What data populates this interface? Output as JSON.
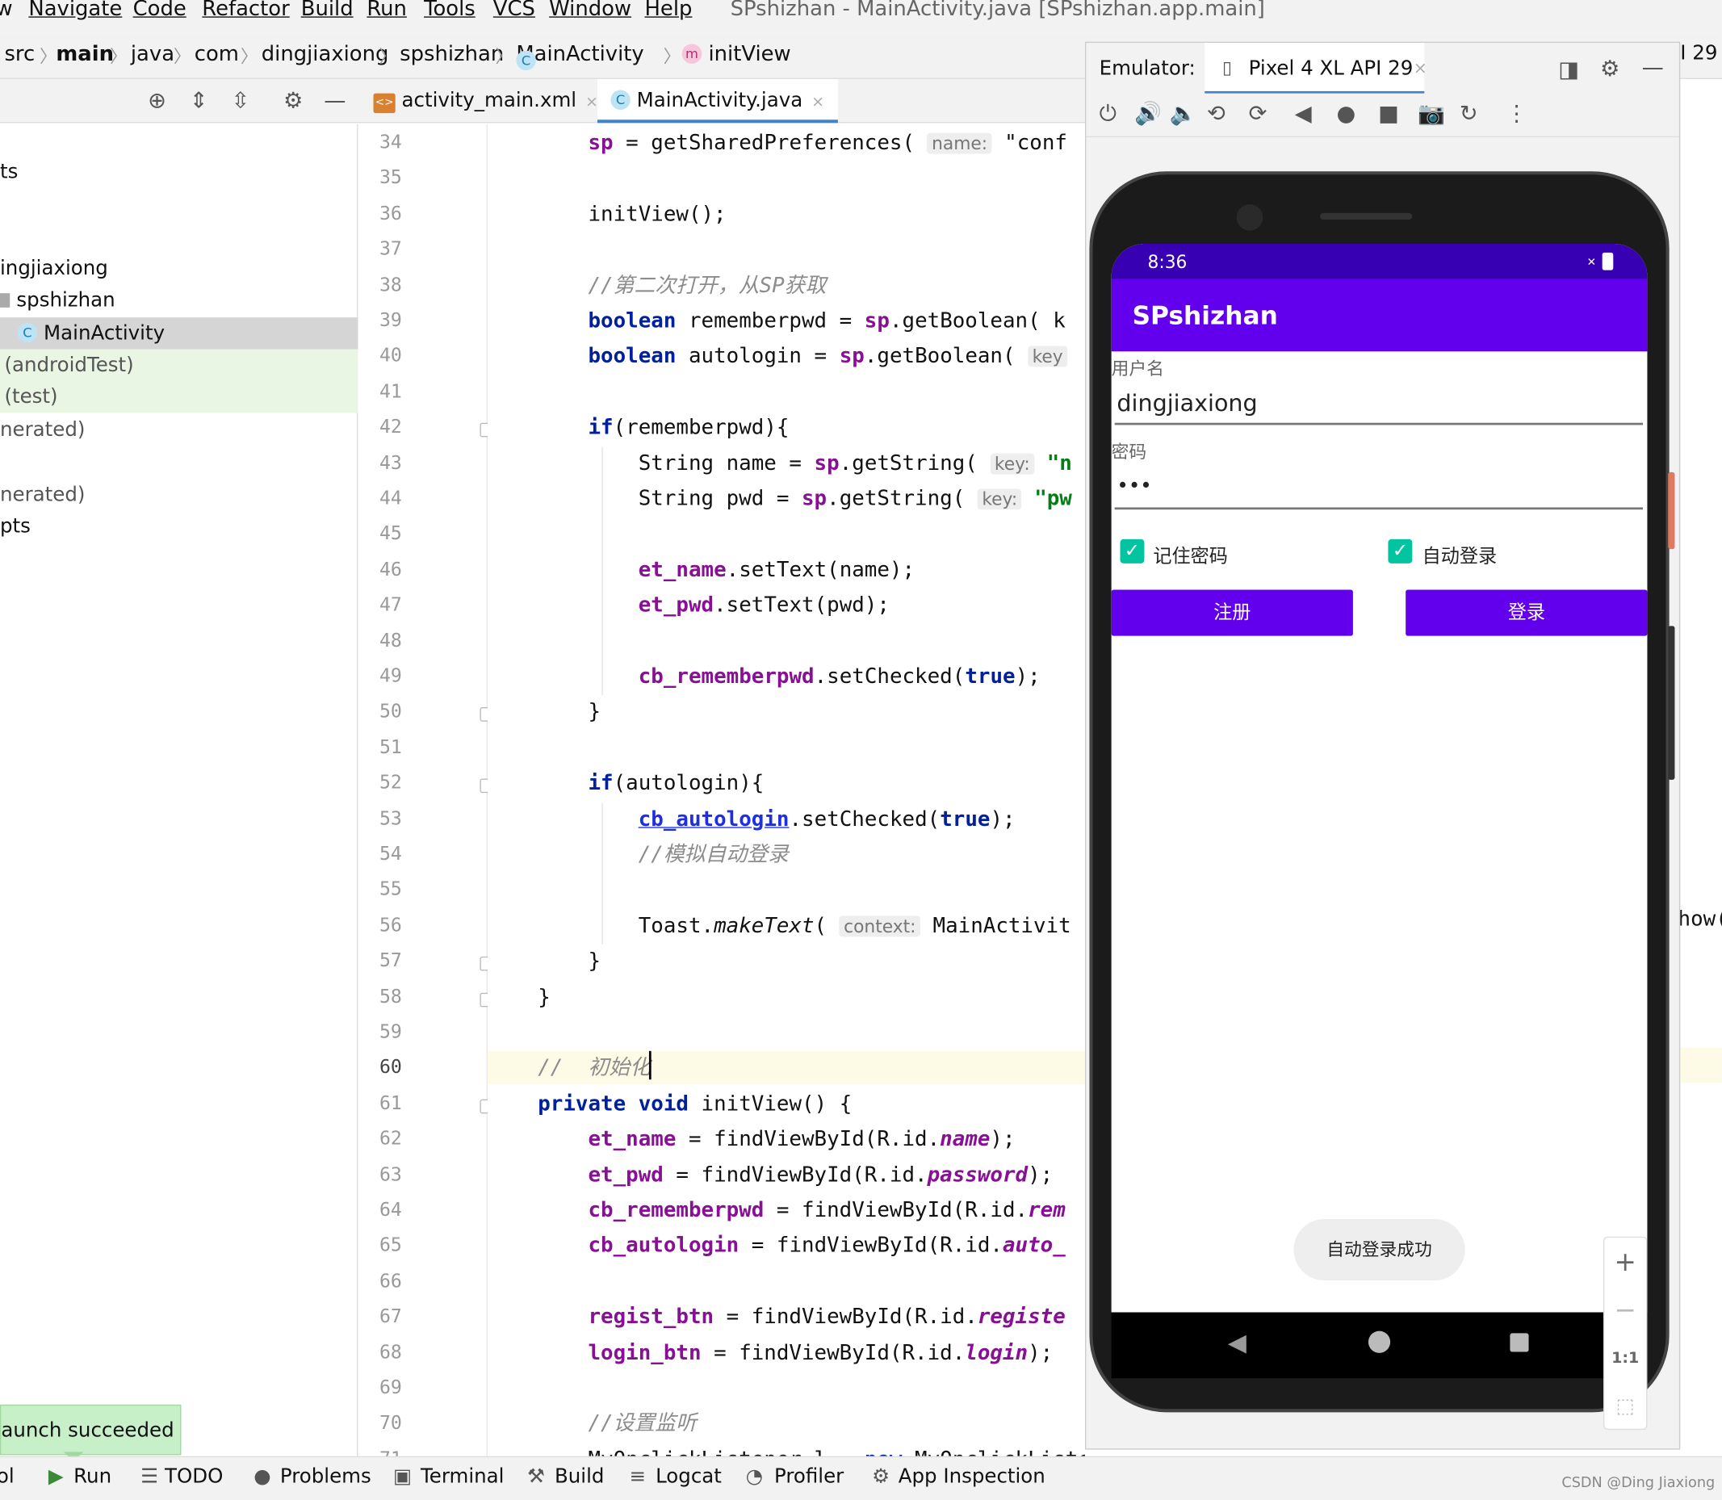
{
  "menu": {
    "items": [
      "w",
      "Navigate",
      "Code",
      "Refactor",
      "Build",
      "Run",
      "Tools",
      "VCS",
      "Window",
      "Help"
    ],
    "window_title": "SPshizhan - MainActivity.java [SPshizhan.app.main]"
  },
  "breadcrumb": {
    "items": [
      "src",
      "main",
      "java",
      "com",
      "dingjiaxiong",
      "spshizhan",
      "MainActivity",
      "initView"
    ],
    "class_badge": "C",
    "method_badge": "m",
    "right_fragment": "I 29"
  },
  "project_tree": {
    "rows": [
      {
        "label": "ts"
      },
      {
        "label": "ingjiaxiong"
      },
      {
        "label": "spshizhan"
      },
      {
        "label": "MainActivity",
        "badge": "C"
      },
      {
        "label": "(androidTest)"
      },
      {
        "label": "(test)"
      },
      {
        "label": "nerated)"
      },
      {
        "label": "nerated)"
      },
      {
        "label": "pts"
      }
    ]
  },
  "editor_tabs": [
    {
      "label": "activity_main.xml",
      "icon": "xml-file-icon",
      "icon_text": "<>",
      "close": "×"
    },
    {
      "label": "MainActivity.java",
      "icon": "java-class-icon",
      "icon_text": "C",
      "close": "×",
      "active": true
    }
  ],
  "editor": {
    "line_numbers": [
      "34",
      "35",
      "36",
      "37",
      "38",
      "39",
      "40",
      "41",
      "42",
      "43",
      "44",
      "45",
      "46",
      "47",
      "48",
      "49",
      "50",
      "51",
      "52",
      "53",
      "54",
      "55",
      "56",
      "57",
      "58",
      "59",
      "60",
      "61",
      "62",
      "63",
      "64",
      "65",
      "66",
      "67",
      "68",
      "69",
      "70",
      "71"
    ],
    "current_line": "60",
    "lines": [
      {
        "segs": [
          [
            "        ",
            ""
          ],
          [
            "sp",
            "fld"
          ],
          [
            " = getSharedPreferences( ",
            ""
          ],
          [
            "name:",
            "hint"
          ],
          [
            " ",
            ""
          ],
          [
            "\"conf",
            ""
          ]
        ]
      },
      {
        "segs": []
      },
      {
        "segs": [
          [
            "        initView();",
            ""
          ]
        ]
      },
      {
        "segs": []
      },
      {
        "segs": [
          [
            "        ",
            ""
          ],
          [
            "//第二次打开，从SP获取",
            "cm"
          ]
        ]
      },
      {
        "segs": [
          [
            "        ",
            ""
          ],
          [
            "boolean",
            "kw"
          ],
          [
            " rememberpwd = ",
            ""
          ],
          [
            "sp",
            "fld"
          ],
          [
            ".getBoolean( k",
            ""
          ]
        ]
      },
      {
        "segs": [
          [
            "        ",
            ""
          ],
          [
            "boolean",
            "kw"
          ],
          [
            " autologin = ",
            ""
          ],
          [
            "sp",
            "fld"
          ],
          [
            ".getBoolean( ",
            ""
          ],
          [
            "key",
            "hint"
          ]
        ]
      },
      {
        "segs": []
      },
      {
        "segs": [
          [
            "        ",
            ""
          ],
          [
            "if",
            "kw"
          ],
          [
            "(rememberpwd){",
            ""
          ]
        ]
      },
      {
        "segs": [
          [
            "            String name = ",
            ""
          ],
          [
            "sp",
            "fld"
          ],
          [
            ".getString( ",
            ""
          ],
          [
            "key:",
            "hint"
          ],
          [
            " ",
            ""
          ],
          [
            "\"n",
            "str"
          ]
        ]
      },
      {
        "segs": [
          [
            "            String pwd = ",
            ""
          ],
          [
            "sp",
            "fld"
          ],
          [
            ".getString( ",
            ""
          ],
          [
            "key:",
            "hint"
          ],
          [
            " ",
            ""
          ],
          [
            "\"pw",
            "str"
          ]
        ]
      },
      {
        "segs": []
      },
      {
        "segs": [
          [
            "            ",
            ""
          ],
          [
            "et_name",
            "fld"
          ],
          [
            ".setText(name);",
            ""
          ]
        ]
      },
      {
        "segs": [
          [
            "            ",
            ""
          ],
          [
            "et_pwd",
            "fld"
          ],
          [
            ".setText(pwd);",
            ""
          ]
        ]
      },
      {
        "segs": []
      },
      {
        "segs": [
          [
            "            ",
            ""
          ],
          [
            "cb_rememberpwd",
            "fld"
          ],
          [
            ".setChecked(",
            ""
          ],
          [
            "true",
            "kw"
          ],
          [
            ");",
            ""
          ]
        ]
      },
      {
        "segs": [
          [
            "        }",
            ""
          ]
        ]
      },
      {
        "segs": []
      },
      {
        "segs": [
          [
            "        ",
            ""
          ],
          [
            "if",
            "kw"
          ],
          [
            "(autologin){",
            ""
          ]
        ]
      },
      {
        "segs": [
          [
            "            ",
            ""
          ],
          [
            "cb_autologin",
            "fldu"
          ],
          [
            ".setChecked(",
            ""
          ],
          [
            "true",
            "kw"
          ],
          [
            ");",
            ""
          ]
        ]
      },
      {
        "segs": [
          [
            "            ",
            ""
          ],
          [
            "//模拟自动登录",
            "cm"
          ]
        ]
      },
      {
        "segs": []
      },
      {
        "segs": [
          [
            "            Toast.",
            ""
          ],
          [
            "makeText",
            "it"
          ],
          [
            "( ",
            ""
          ],
          [
            "context:",
            "hint"
          ],
          [
            " MainActivit",
            ""
          ]
        ]
      },
      {
        "segs": [
          [
            "        }",
            ""
          ]
        ]
      },
      {
        "segs": [
          [
            "    }",
            ""
          ]
        ]
      },
      {
        "segs": []
      },
      {
        "segs": [
          [
            "    ",
            ""
          ],
          [
            "//  初始化",
            "cm"
          ]
        ]
      },
      {
        "segs": [
          [
            "    ",
            ""
          ],
          [
            "private void",
            "kw"
          ],
          [
            " initView() {",
            ""
          ]
        ]
      },
      {
        "segs": [
          [
            "        ",
            ""
          ],
          [
            "et_name",
            "fld"
          ],
          [
            " = findViewById(R.id.",
            ""
          ],
          [
            "name",
            "itf"
          ],
          [
            ");",
            ""
          ]
        ]
      },
      {
        "segs": [
          [
            "        ",
            ""
          ],
          [
            "et_pwd",
            "fld"
          ],
          [
            " = findViewById(R.id.",
            ""
          ],
          [
            "password",
            "itf"
          ],
          [
            ");",
            ""
          ]
        ]
      },
      {
        "segs": [
          [
            "        ",
            ""
          ],
          [
            "cb_rememberpwd",
            "fld"
          ],
          [
            " = findViewById(R.id.",
            ""
          ],
          [
            "rem",
            "itf"
          ]
        ]
      },
      {
        "segs": [
          [
            "        ",
            ""
          ],
          [
            "cb_autologin",
            "fld"
          ],
          [
            " = findViewById(R.id.",
            ""
          ],
          [
            "auto_",
            "itf"
          ]
        ]
      },
      {
        "segs": []
      },
      {
        "segs": [
          [
            "        ",
            ""
          ],
          [
            "regist_btn",
            "fld"
          ],
          [
            " = findViewById(R.id.",
            ""
          ],
          [
            "registe",
            "itf"
          ]
        ]
      },
      {
        "segs": [
          [
            "        ",
            ""
          ],
          [
            "login_btn",
            "fld"
          ],
          [
            " = findViewById(R.id.",
            ""
          ],
          [
            "login",
            "itf"
          ],
          [
            ");",
            ""
          ]
        ]
      },
      {
        "segs": []
      },
      {
        "segs": [
          [
            "        ",
            ""
          ],
          [
            "//设置监听",
            "cm"
          ]
        ]
      },
      {
        "segs": [
          [
            "        MyOnclickListener l = ",
            ""
          ],
          [
            "new",
            "kw"
          ],
          [
            " MyOnclickListener();",
            ""
          ]
        ]
      }
    ],
    "overflow_text": "how("
  },
  "emulator": {
    "label": "Emulator:",
    "device": "Pixel 4 XL API 29",
    "close": "×",
    "toolbar_icons": [
      "power-icon",
      "volume-up-icon",
      "volume-down-icon",
      "rotate-left-icon",
      "rotate-right-icon",
      "back-icon",
      "home-icon",
      "overview-icon",
      "screenshot-icon",
      "snapshot-icon",
      "more-icon"
    ],
    "zoom": {
      "plus": "+",
      "minus": "−",
      "one_to_one": "1:1"
    }
  },
  "phone": {
    "time": "8:36",
    "app_title": "SPshizhan",
    "username_label": "用户名",
    "username_value": "dingjiaxiong",
    "password_label": "密码",
    "password_value": "•••",
    "remember_label": "记住密码",
    "remember_checked": true,
    "autologin_label": "自动登录",
    "autologin_checked": true,
    "register_button": "注册",
    "login_button": "登录",
    "toast": "自动登录成功",
    "accent_color": "#6200ee",
    "status_color": "#3700b3",
    "checkbox_color": "#03c4a1"
  },
  "bottom_bar": {
    "items": [
      "ol",
      "Run",
      "TODO",
      "Problems",
      "Terminal",
      "Build",
      "Logcat",
      "Profiler",
      "App Inspection"
    ],
    "launch_notice": "aunch succeeded"
  },
  "watermark": "CSDN @Ding Jiaxiong"
}
